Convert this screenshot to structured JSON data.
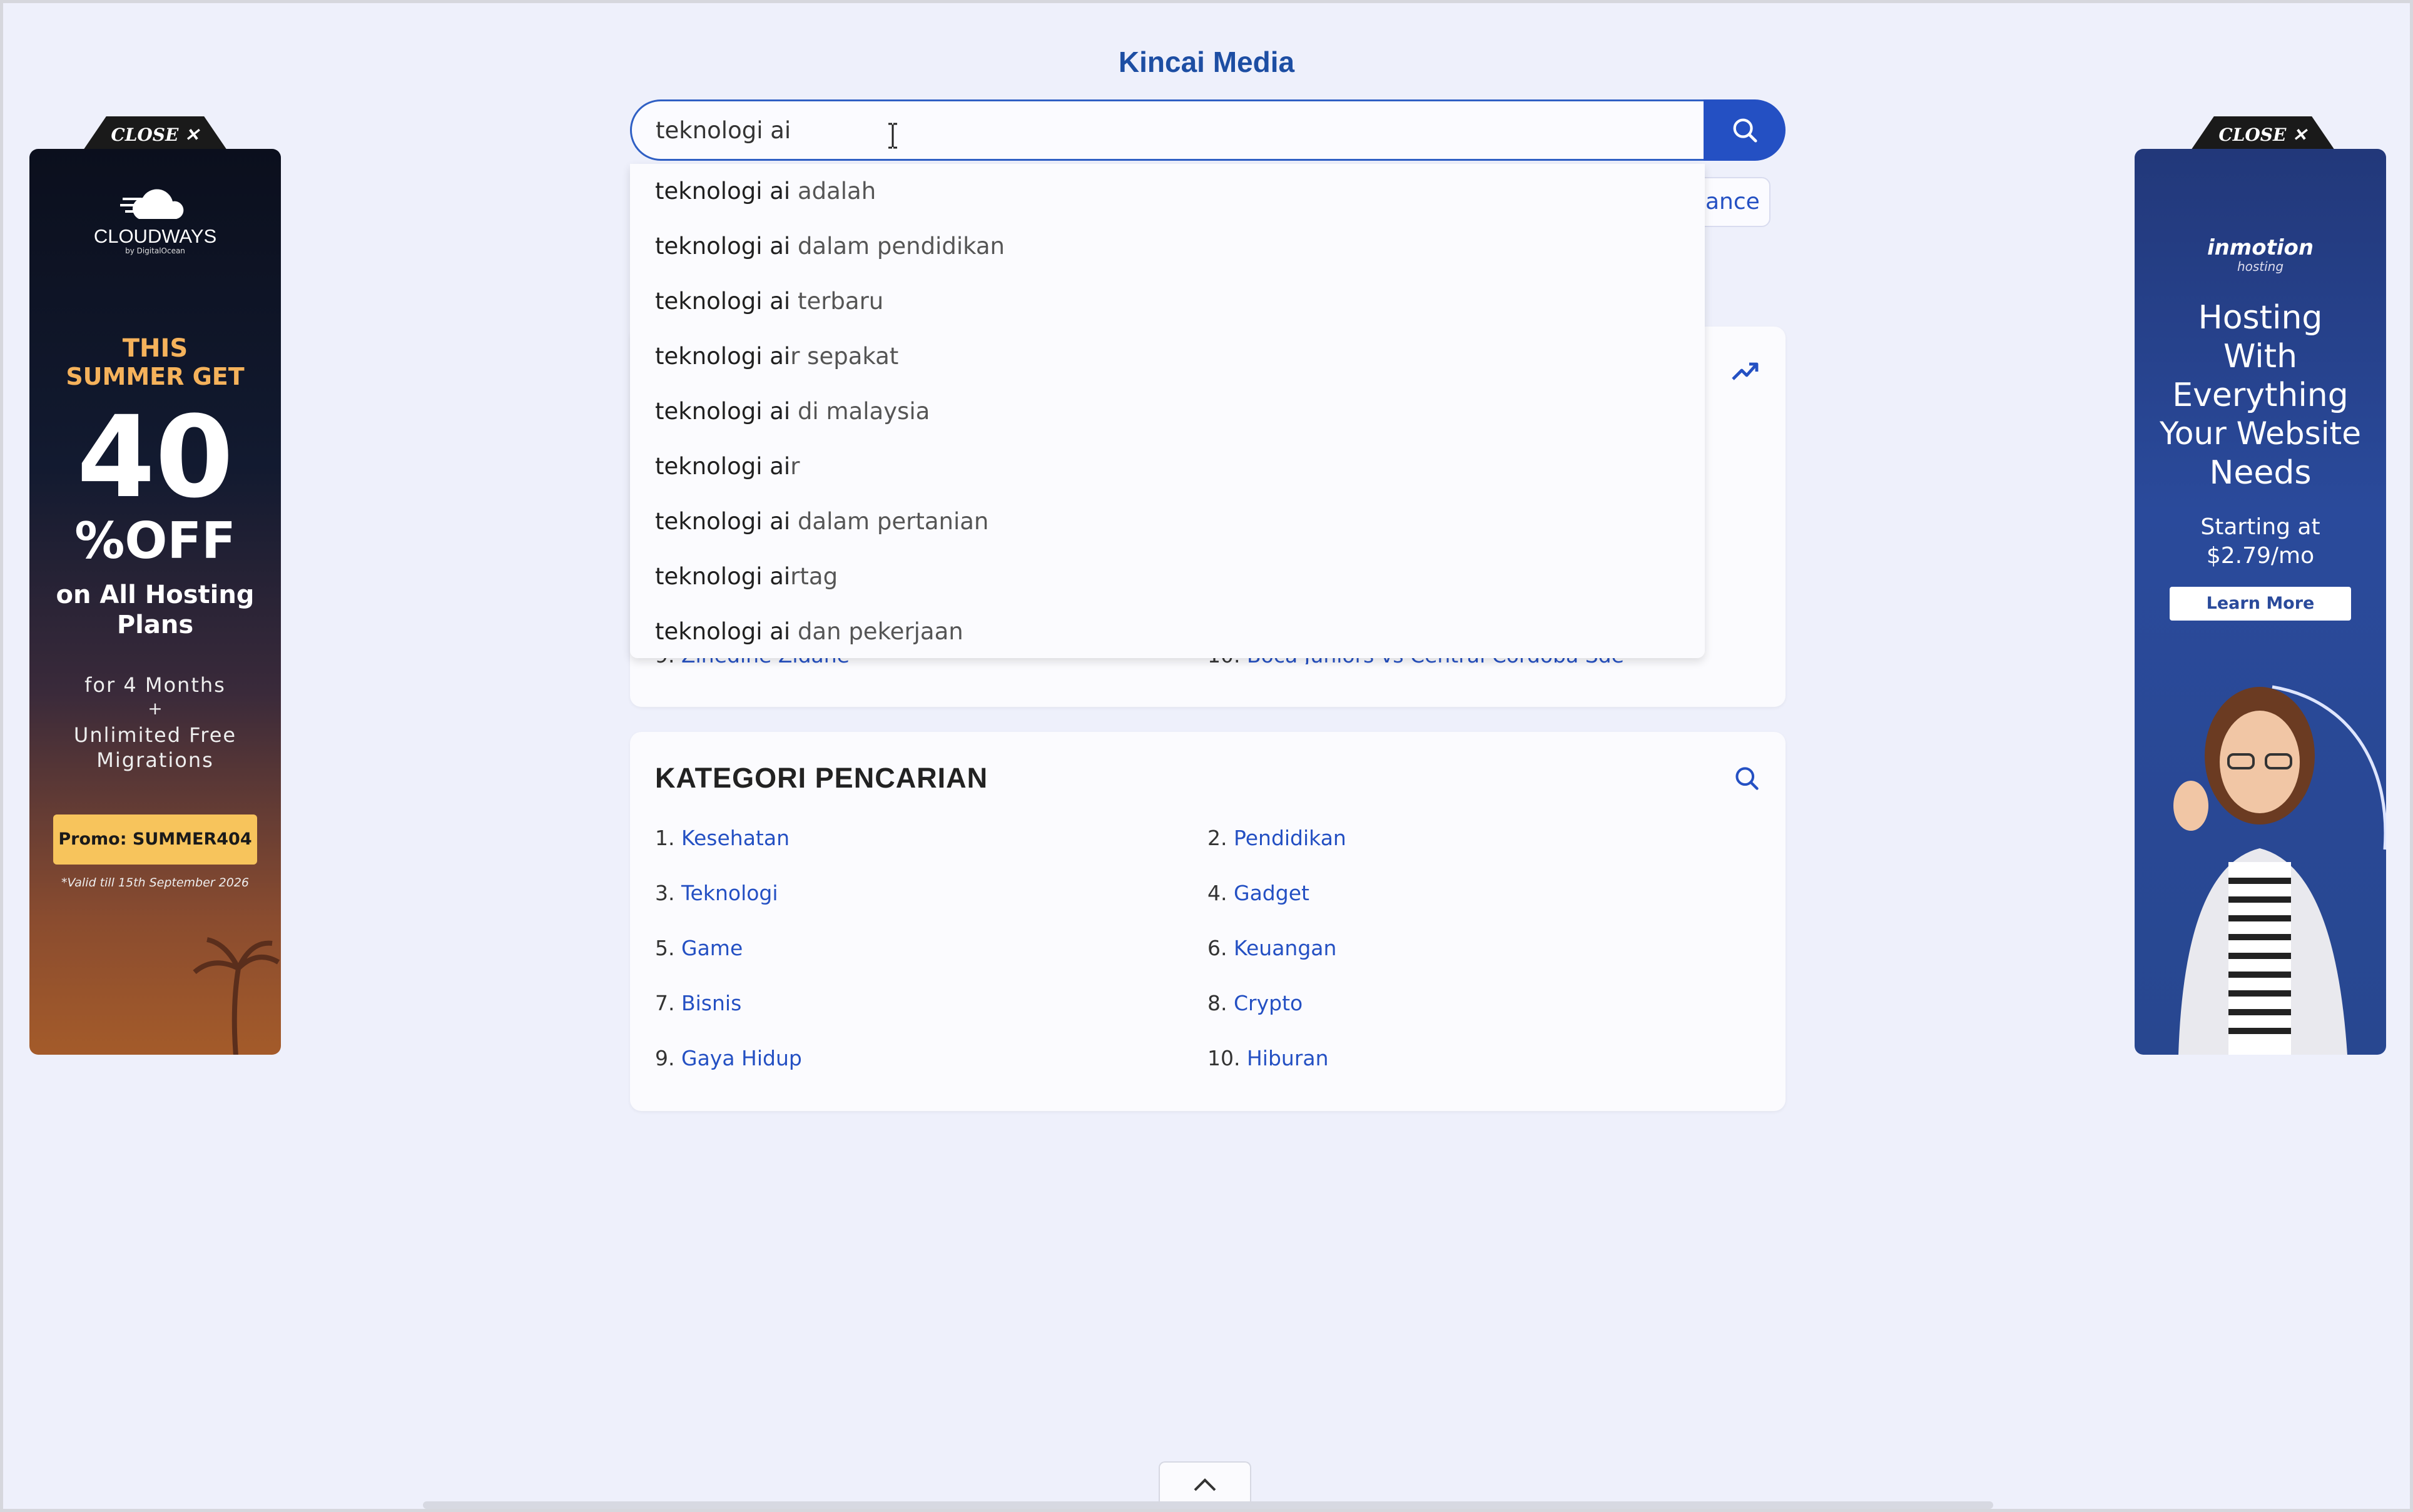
{
  "site": {
    "title": "Kincai Media"
  },
  "search": {
    "value": "teknologi ai",
    "typed": "teknologi ai",
    "suggestions": [
      {
        "prefix": "teknologi ai",
        "rest": " adalah"
      },
      {
        "prefix": "teknologi ai",
        "rest": " dalam pendidikan"
      },
      {
        "prefix": "teknologi ai",
        "rest": " terbaru"
      },
      {
        "prefix": "teknologi ai",
        "rest": "r sepakat"
      },
      {
        "prefix": "teknologi ai",
        "rest": " di malaysia"
      },
      {
        "prefix": "teknologi ai",
        "rest": "r"
      },
      {
        "prefix": "teknologi ai",
        "rest": " dalam pertanian"
      },
      {
        "prefix": "teknologi ai",
        "rest": "rtag"
      },
      {
        "prefix": "teknologi ai",
        "rest": " dan pekerjaan"
      }
    ]
  },
  "chip": {
    "label": "ance"
  },
  "trending": {
    "peek": [
      {
        "num": "9.",
        "label": "Zinedine Zidane"
      },
      {
        "num": "10.",
        "label": "Boca Juniors vs Central Córdoba Sde"
      }
    ]
  },
  "kategori": {
    "title": "KATEGORI PENCARIAN",
    "items": [
      {
        "num": "1.",
        "label": "Kesehatan"
      },
      {
        "num": "2.",
        "label": "Pendidikan"
      },
      {
        "num": "3.",
        "label": "Teknologi"
      },
      {
        "num": "4.",
        "label": "Gadget"
      },
      {
        "num": "5.",
        "label": "Game"
      },
      {
        "num": "6.",
        "label": "Keuangan"
      },
      {
        "num": "7.",
        "label": "Bisnis"
      },
      {
        "num": "8.",
        "label": "Crypto"
      },
      {
        "num": "9.",
        "label": "Gaya Hidup"
      },
      {
        "num": "10.",
        "label": "Hiburan"
      }
    ]
  },
  "ads": {
    "close_label": "CLOSE ✕",
    "left": {
      "brand": "CLOUDWAYS",
      "brand_sub": "by DigitalOcean",
      "line1": "THIS",
      "line2": "SUMMER GET",
      "big": "40",
      "pct": "%OFF",
      "line3": "on All Hosting",
      "line4": "Plans",
      "line5": "for 4 Months",
      "line6": "+",
      "line7": "Unlimited Free",
      "line8": "Migrations",
      "promo": "Promo: SUMMER404",
      "valid": "*Valid till 15th September 2026"
    },
    "right": {
      "brand": "inmotion",
      "brand_sub": "hosting",
      "l1": "Hosting",
      "l2": "With",
      "l3": "Everything",
      "l4": "Your Website",
      "l5": "Needs",
      "l6": "Starting at",
      "l7": "$2.79/mo",
      "cta": "Learn More"
    }
  },
  "colors": {
    "accent": "#2450c3",
    "title": "#1d4ea3",
    "bg": "#eef0fb"
  }
}
